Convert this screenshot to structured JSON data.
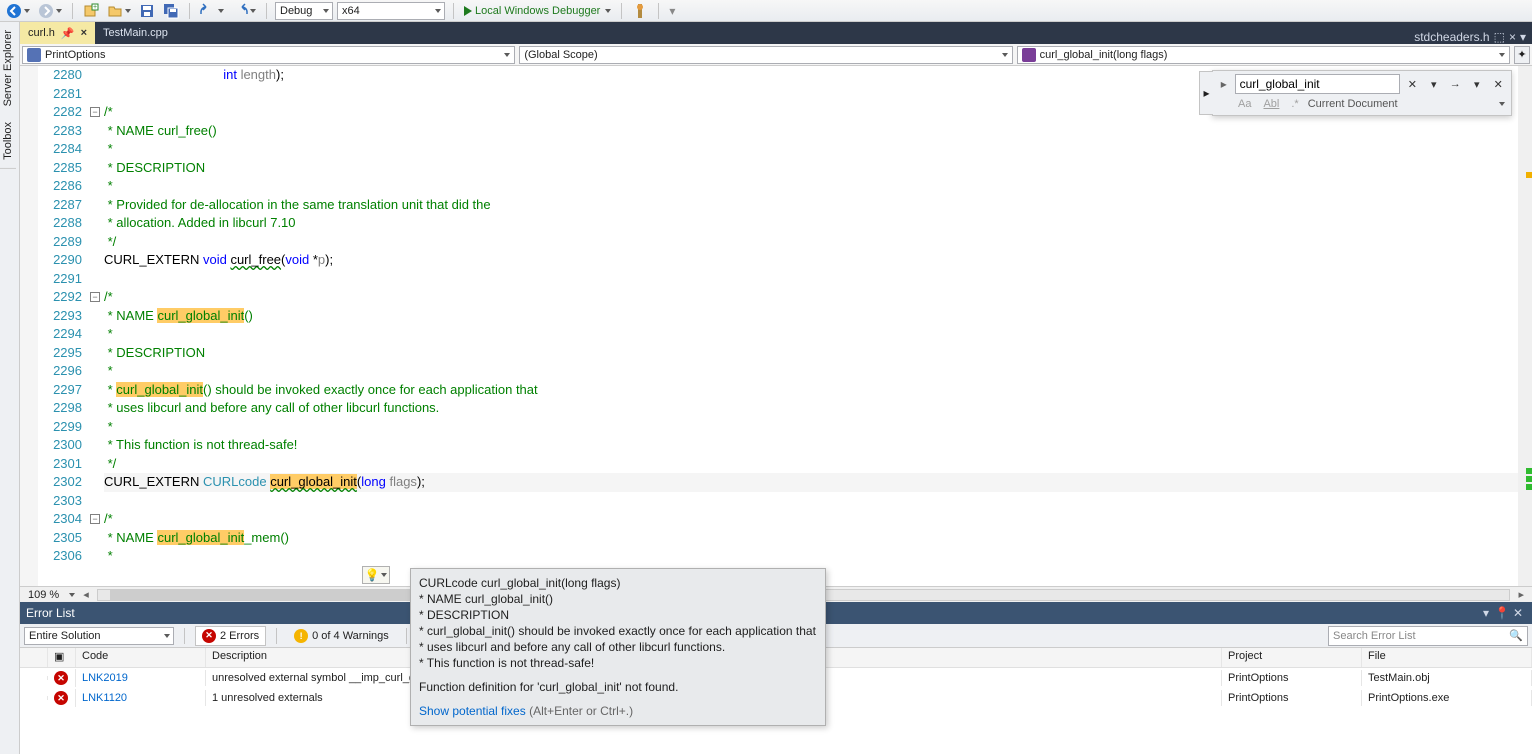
{
  "toolbar": {
    "config": "Debug",
    "platform": "x64",
    "run_label": "Local Windows Debugger"
  },
  "sidebars": {
    "server_explorer": "Server Explorer",
    "toolbox": "Toolbox"
  },
  "tabs": {
    "active": "curl.h",
    "other": "TestMain.cpp",
    "right_file": "stdcheaders.h"
  },
  "nav": {
    "left": "PrintOptions",
    "middle": "(Global Scope)",
    "right": "curl_global_init(long flags)"
  },
  "find": {
    "value": "curl_global_init",
    "scope": "Current Document",
    "aa": "Aa",
    "abl": "Abl",
    "regex": ".*"
  },
  "code": {
    "start": 2280,
    "hl_term": "curl_global_init",
    "lines": [
      {
        "n": 2280,
        "seg": [
          {
            "t": "                                 "
          },
          {
            "t": "int",
            "c": "kw"
          },
          {
            "t": " "
          },
          {
            "t": "length",
            "c": "param"
          },
          {
            "t": ");"
          }
        ]
      },
      {
        "n": 2281,
        "seg": []
      },
      {
        "n": 2282,
        "fold": "-",
        "seg": [
          {
            "t": "/*",
            "c": "cmt"
          }
        ]
      },
      {
        "n": 2283,
        "seg": [
          {
            "t": " * NAME curl_free()",
            "c": "cmt"
          }
        ]
      },
      {
        "n": 2284,
        "seg": [
          {
            "t": " *",
            "c": "cmt"
          }
        ]
      },
      {
        "n": 2285,
        "seg": [
          {
            "t": " * DESCRIPTION",
            "c": "cmt"
          }
        ]
      },
      {
        "n": 2286,
        "seg": [
          {
            "t": " *",
            "c": "cmt"
          }
        ]
      },
      {
        "n": 2287,
        "seg": [
          {
            "t": " * Provided for de-allocation in the same translation unit that did the",
            "c": "cmt"
          }
        ]
      },
      {
        "n": 2288,
        "seg": [
          {
            "t": " * allocation. Added in libcurl 7.10",
            "c": "cmt"
          }
        ]
      },
      {
        "n": 2289,
        "seg": [
          {
            "t": " */",
            "c": "cmt"
          }
        ]
      },
      {
        "n": 2290,
        "seg": [
          {
            "t": "CURL_EXTERN "
          },
          {
            "t": "void",
            "c": "kw"
          },
          {
            "t": " "
          },
          {
            "t": "curl_free",
            "sq": true
          },
          {
            "t": "("
          },
          {
            "t": "void",
            "c": "kw"
          },
          {
            "t": " *"
          },
          {
            "t": "p",
            "c": "param"
          },
          {
            "t": ");"
          }
        ]
      },
      {
        "n": 2291,
        "seg": []
      },
      {
        "n": 2292,
        "fold": "-",
        "seg": [
          {
            "t": "/*",
            "c": "cmt"
          }
        ]
      },
      {
        "n": 2293,
        "seg": [
          {
            "t": " * NAME ",
            "c": "cmt"
          },
          {
            "t": "curl_global_init",
            "c": "cmt",
            "hl": true
          },
          {
            "t": "()",
            "c": "cmt"
          }
        ]
      },
      {
        "n": 2294,
        "seg": [
          {
            "t": " *",
            "c": "cmt"
          }
        ]
      },
      {
        "n": 2295,
        "seg": [
          {
            "t": " * DESCRIPTION",
            "c": "cmt"
          }
        ]
      },
      {
        "n": 2296,
        "seg": [
          {
            "t": " *",
            "c": "cmt"
          }
        ]
      },
      {
        "n": 2297,
        "seg": [
          {
            "t": " * ",
            "c": "cmt"
          },
          {
            "t": "curl_global_init",
            "c": "cmt",
            "hl": true
          },
          {
            "t": "() should be invoked exactly once for each application that",
            "c": "cmt"
          }
        ]
      },
      {
        "n": 2298,
        "seg": [
          {
            "t": " * uses libcurl and before any call of other libcurl functions.",
            "c": "cmt"
          }
        ]
      },
      {
        "n": 2299,
        "seg": [
          {
            "t": " *",
            "c": "cmt"
          }
        ]
      },
      {
        "n": 2300,
        "seg": [
          {
            "t": " * This function is not thread-safe!",
            "c": "cmt"
          }
        ]
      },
      {
        "n": 2301,
        "seg": [
          {
            "t": " */",
            "c": "cmt"
          }
        ]
      },
      {
        "n": 2302,
        "cur": true,
        "seg": [
          {
            "t": "CURL_EXTERN "
          },
          {
            "t": "CURLcode",
            "c": "typ"
          },
          {
            "t": " "
          },
          {
            "t": "curl_global_init",
            "hl": true,
            "sq": true
          },
          {
            "t": "("
          },
          {
            "t": "long",
            "c": "kw"
          },
          {
            "t": " "
          },
          {
            "t": "flags",
            "c": "param"
          },
          {
            "t": ");"
          }
        ]
      },
      {
        "n": 2303,
        "seg": []
      },
      {
        "n": 2304,
        "fold": "-",
        "seg": [
          {
            "t": "/*",
            "c": "cmt"
          }
        ]
      },
      {
        "n": 2305,
        "seg": [
          {
            "t": " * NAME ",
            "c": "cmt"
          },
          {
            "t": "curl_global_init",
            "c": "cmt",
            "hl": true
          },
          {
            "t": "_mem()",
            "c": "cmt"
          }
        ]
      },
      {
        "n": 2306,
        "seg": [
          {
            "t": " *",
            "c": "cmt"
          }
        ]
      }
    ]
  },
  "tooltip": {
    "l1": "CURLcode curl_global_init(long flags)",
    "l2": "* NAME curl_global_init()",
    "l3": "* DESCRIPTION",
    "l4": "* curl_global_init() should be invoked exactly once for each application that",
    "l5": "* uses libcurl and before any call of other libcurl functions.",
    "l6": "* This function is not thread-safe!",
    "status": "Function definition for 'curl_global_init' not found.",
    "link": "Show potential fixes",
    "shortcut": "(Alt+Enter or Ctrl+.)"
  },
  "zoom": "109 %",
  "error_list": {
    "title": "Error List",
    "scope": "Entire Solution",
    "errors_label": "2 Errors",
    "warnings_label": "0 of 4 Warnings",
    "search_ph": "Search Error List",
    "cols": {
      "code": "Code",
      "desc": "Description",
      "proj": "Project",
      "file": "File"
    },
    "rows": [
      {
        "code": "LNK2019",
        "desc": "unresolved external symbol __imp_curl_global_init referenced in function \"void __cdecl testCurl(void)\" (?testCurl@@YAXXZ)",
        "proj": "PrintOptions",
        "file": "TestMain.obj"
      },
      {
        "code": "LNK1120",
        "desc": "1 unresolved externals",
        "proj": "PrintOptions",
        "file": "PrintOptions.exe"
      }
    ]
  }
}
